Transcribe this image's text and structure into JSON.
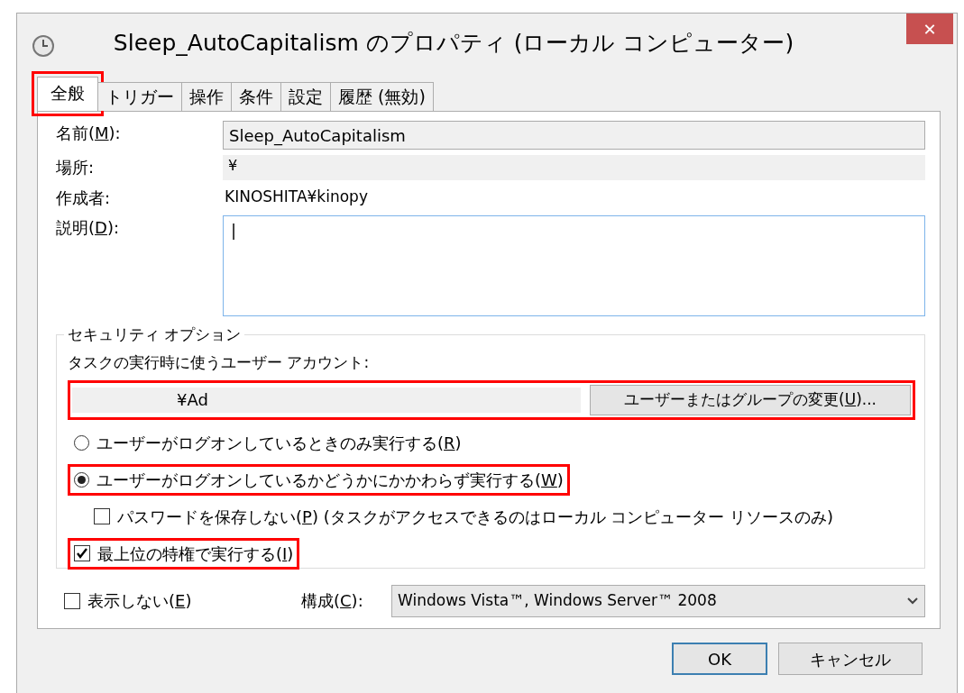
{
  "window": {
    "title": "Sleep_AutoCapitalism のプロパティ (ローカル コンピューター)",
    "close": "✕"
  },
  "tabs": [
    {
      "label": "全般",
      "selected": true,
      "highlighted": true
    },
    {
      "label": "トリガー",
      "selected": false,
      "highlighted": false
    },
    {
      "label": "操作",
      "selected": false,
      "highlighted": false
    },
    {
      "label": "条件",
      "selected": false,
      "highlighted": false
    },
    {
      "label": "設定",
      "selected": false,
      "highlighted": false
    },
    {
      "label": "履歴 (無効)",
      "selected": false,
      "highlighted": false
    }
  ],
  "fields": [
    {
      "kind": "input",
      "label": "名前(",
      "key": "M",
      "label_end": "):",
      "value": "Sleep_AutoCapitalism"
    },
    {
      "kind": "readonly",
      "label": "場所:",
      "value": "¥"
    },
    {
      "kind": "plain",
      "label": "作成者:",
      "value": "KINOSHITA¥kinopy"
    },
    {
      "kind": "textarea",
      "label": "説明(",
      "key": "D",
      "label_end": "):",
      "value": "|"
    }
  ],
  "security": {
    "title": "セキュリティ オプション",
    "account_label": "タスクの実行時に使うユーザー アカウント:",
    "account": "¥Ad",
    "account_highlighted": true,
    "change_button": {
      "label": "ユーザーまたはグループの変更(",
      "key": "U",
      "label_end": ")..."
    },
    "options": [
      {
        "kind": "radio",
        "label": "ユーザーがログオンしているときのみ実行する(",
        "key": "R",
        "label_end": ")",
        "selected": false,
        "highlighted": false
      },
      {
        "kind": "radio",
        "label": "ユーザーがログオンしているかどうかにかかわらず実行する(",
        "key": "W",
        "label_end": ")",
        "selected": true,
        "highlighted": true,
        "children": [
          {
            "kind": "checkbox",
            "label": "パスワードを保存しない(",
            "key": "P",
            "label_end": ") (タスクがアクセスできるのはローカル コンピューター リソースのみ)",
            "checked": false,
            "highlighted": false
          }
        ]
      },
      {
        "kind": "checkbox",
        "label": "最上位の特権で実行する(",
        "key": "I",
        "label_end": ")",
        "checked": true,
        "highlighted": true
      }
    ]
  },
  "hidden_option": {
    "label": "表示しない(",
    "key": "E",
    "label_end": ")",
    "checked": false
  },
  "configure": {
    "label": "構成(",
    "key": "C",
    "label_end": "):",
    "value": "Windows Vista™, Windows Server™ 2008"
  },
  "buttons": [
    {
      "label": "OK",
      "default": true
    },
    {
      "label": "キャンセル",
      "default": false
    }
  ]
}
